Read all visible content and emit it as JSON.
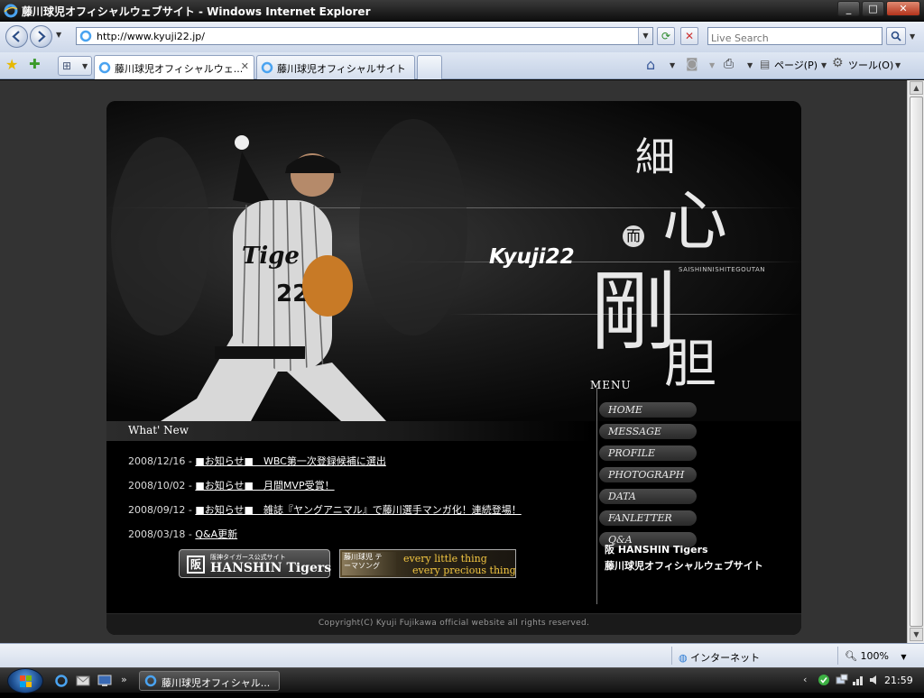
{
  "window": {
    "title": "藤川球児オフィシャルウェブサイト - Windows Internet Explorer",
    "min_label": "_",
    "max_label": "□",
    "close_label": "✕"
  },
  "address_bar": {
    "url": "http://www.kyuji22.jp/",
    "search_placeholder": "Live Search"
  },
  "tabs": [
    {
      "label": "藤川球児オフィシャルウェ...",
      "close": "✕"
    },
    {
      "label": "藤川球児オフィシャルサイト"
    }
  ],
  "commands": {
    "page": "ページ(P)",
    "tools": "ツール(O)"
  },
  "site": {
    "logo": "Kyuji22",
    "kanji": [
      "細",
      "心",
      "而",
      "剛",
      "胆"
    ],
    "tagline": "SAISHINNISHITEGOUTAN",
    "news_heading": "What' New",
    "news": [
      {
        "date": "2008/12/16 -",
        "link": "■お知らせ■　WBC第一次登録候補に選出"
      },
      {
        "date": "2008/10/02 -",
        "link": "■お知らせ■　月間MVP受賞！"
      },
      {
        "date": "2008/09/12 -",
        "link": "■お知らせ■　雑誌『ヤングアニマル』で藤川選手マンガ化！連続登場！"
      },
      {
        "date": "2008/03/18 -",
        "link": "Q&A更新"
      }
    ],
    "menu_title": "MENU",
    "menu": [
      "HOME",
      "MESSAGE",
      "PROFILE",
      "PHOTOGRAPH",
      "DATA",
      "FANLETTER",
      "Q&A"
    ],
    "hanshin_note": "阪 HANSHIN Tigers",
    "hanshin_note_sub": "藤川球児オフィシャルウェブサイト",
    "banner_hanshin": {
      "mark": "阪",
      "small": "阪神タイガース公式サイト",
      "big": "HANSHIN Tigers"
    },
    "banner_song": {
      "title": "藤川球児 テーマソング",
      "line1": "every little thing",
      "line2": "every precious thing"
    },
    "footer": "Copyright(C) Kyuji Fujikawa official website all rights reserved."
  },
  "status": {
    "zone": "インターネット",
    "zoom": "100%"
  },
  "taskbar": {
    "item": "藤川球児オフィシャル...",
    "clock": "21:59"
  },
  "colors": {
    "accent_gold": "#f5c842",
    "site_bg": "#000000",
    "page_bg": "#333333"
  }
}
